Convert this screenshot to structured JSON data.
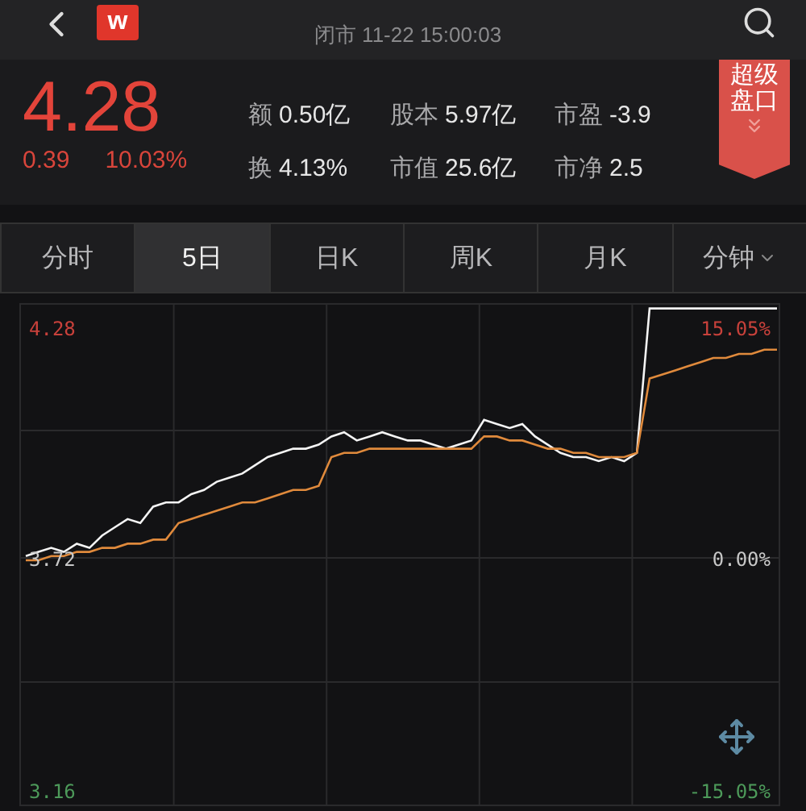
{
  "header": {
    "logo": "w",
    "status": "闭市 11-22 15:00:03"
  },
  "quote": {
    "price": "4.28",
    "change": "0.39",
    "change_pct": "10.03%",
    "stats": [
      {
        "label": "额",
        "value": "0.50亿"
      },
      {
        "label": "股本",
        "value": "5.97亿"
      },
      {
        "label": "市盈",
        "value": "-3.9"
      },
      {
        "label": "换",
        "value": "4.13%"
      },
      {
        "label": "市值",
        "value": "25.6亿"
      },
      {
        "label": "市净",
        "value": "2.5"
      }
    ],
    "super_panel": "超级盘口"
  },
  "tabs": [
    {
      "label": "分时",
      "selected": false,
      "kind": "plain"
    },
    {
      "label": "5日",
      "selected": true,
      "kind": "plain"
    },
    {
      "label": "日K",
      "selected": false,
      "kind": "plain"
    },
    {
      "label": "周K",
      "selected": false,
      "kind": "plain"
    },
    {
      "label": "月K",
      "selected": false,
      "kind": "plain"
    },
    {
      "label": "分钟",
      "selected": false,
      "kind": "dropdown"
    }
  ],
  "chart": {
    "levels": [
      {
        "pct": "15.05%",
        "color": "#c8413b"
      },
      {
        "pct": "0.00%",
        "color": "#c8c8c8"
      },
      {
        "pct": "-15.05%",
        "color": "#4d9a5a"
      }
    ],
    "chart_data": {
      "type": "line",
      "ylim": [
        3.128,
        4.339
      ],
      "yticks": [
        {
          "value": 4.28,
          "label": "4.28"
        },
        {
          "value": 3.72,
          "label": "3.72"
        },
        {
          "value": 3.16,
          "label": "3.16"
        }
      ],
      "series": [
        {
          "color": "#f4f4f4",
          "values": [
            3.73,
            3.74,
            3.75,
            3.74,
            3.76,
            3.75,
            3.78,
            3.8,
            3.82,
            3.81,
            3.85,
            3.86,
            3.86,
            3.88,
            3.89,
            3.91,
            3.92,
            3.93,
            3.95,
            3.97,
            3.98,
            3.99,
            3.99,
            4.0,
            4.02,
            4.03,
            4.01,
            4.02,
            4.03,
            4.02,
            4.01,
            4.01,
            4.0,
            3.99,
            4.0,
            4.01,
            4.06,
            4.05,
            4.04,
            4.05,
            4.02,
            4.0,
            3.98,
            3.97,
            3.97,
            3.96,
            3.97,
            3.96,
            3.98,
            4.33,
            4.33,
            4.33,
            4.33,
            4.33,
            4.33,
            4.33,
            4.33,
            4.33,
            4.33,
            4.33
          ]
        },
        {
          "color": "#e08a3c",
          "values": [
            3.72,
            3.72,
            3.73,
            3.73,
            3.74,
            3.74,
            3.75,
            3.75,
            3.76,
            3.76,
            3.77,
            3.77,
            3.81,
            3.82,
            3.83,
            3.84,
            3.85,
            3.86,
            3.86,
            3.87,
            3.88,
            3.89,
            3.89,
            3.9,
            3.97,
            3.98,
            3.98,
            3.99,
            3.99,
            3.99,
            3.99,
            3.99,
            3.99,
            3.99,
            3.99,
            3.99,
            4.02,
            4.02,
            4.01,
            4.01,
            4.0,
            3.99,
            3.99,
            3.98,
            3.98,
            3.97,
            3.97,
            3.97,
            3.98,
            4.16,
            4.17,
            4.18,
            4.19,
            4.2,
            4.21,
            4.21,
            4.22,
            4.22,
            4.23,
            4.23
          ]
        }
      ]
    }
  }
}
